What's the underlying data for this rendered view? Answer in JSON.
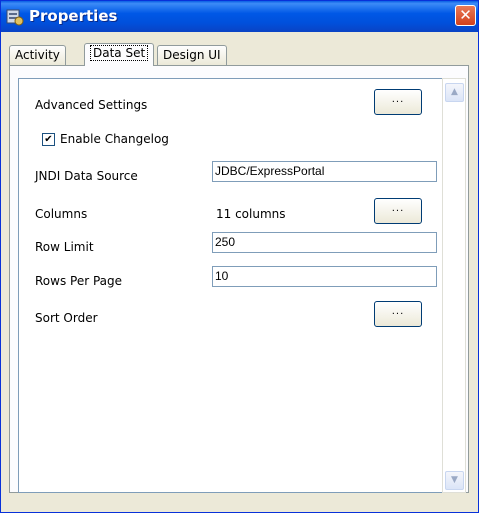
{
  "window": {
    "title": "Properties",
    "close_symbol": "✕"
  },
  "tabs": [
    {
      "label": "Activity",
      "active": false
    },
    {
      "label": "Data Set",
      "active": true
    },
    {
      "label": "Design UI",
      "active": false
    }
  ],
  "form": {
    "advanced_settings_label": "Advanced Settings",
    "advanced_settings_button": "...",
    "enable_changelog_label": "Enable Changelog",
    "enable_changelog_checked": true,
    "enable_changelog_mark": "✔",
    "jndi_label": "JNDI Data Source",
    "jndi_value": "JDBC/ExpressPortal",
    "columns_label": "Columns",
    "columns_value": "11 columns",
    "columns_button": "...",
    "row_limit_label": "Row Limit",
    "row_limit_value": "250",
    "rows_per_page_label": "Rows Per Page",
    "rows_per_page_value": "10",
    "sort_order_label": "Sort Order",
    "sort_order_button": "..."
  },
  "scrollbar": {
    "up_icon": "▲",
    "down_icon": "▼"
  }
}
